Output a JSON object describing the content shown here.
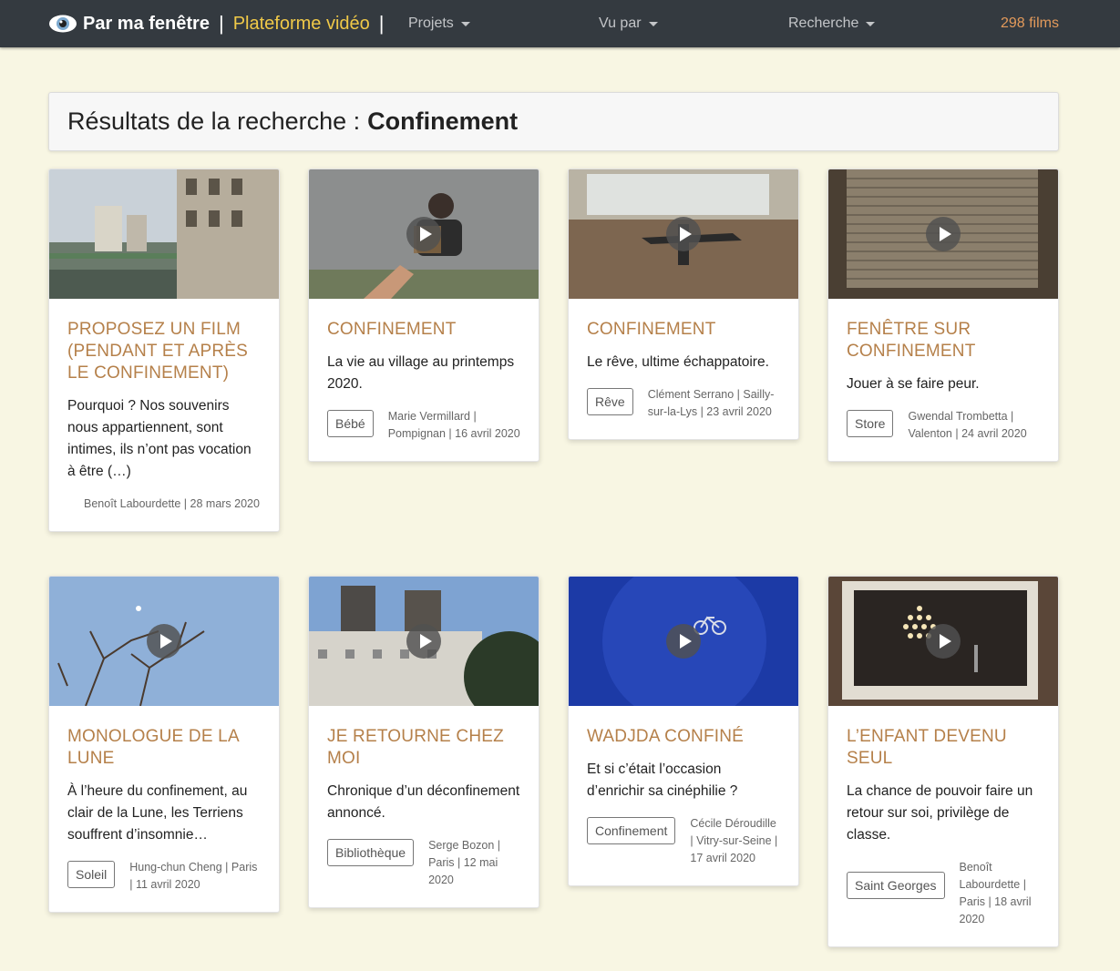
{
  "navbar": {
    "brand": "Par ma fenêtre",
    "separator": "|",
    "subtitle": "Plateforme vidéo",
    "menu": [
      {
        "label": "Projets"
      },
      {
        "label": "Vu par"
      },
      {
        "label": "Recherche"
      }
    ],
    "count": "298 films"
  },
  "search": {
    "prefix": "Résultats de la recherche :",
    "query": "Confinement"
  },
  "colors": {
    "navbar_bg": "#343a40",
    "brand_accent": "#f0c948",
    "count_accent": "#e39a5b",
    "title_accent": "#b5804a",
    "page_bg": "#f8f6e3"
  },
  "cards": [
    {
      "title": "Proposez un film (pendant et après le confinement)",
      "desc": "Pourquoi ? Nos souvenirs nous appartiennent, sont intimes, ils n’ont pas vocation à être (…)",
      "tag": "",
      "meta": "Benoît Labourdette | 28 mars 2020",
      "has_play": false,
      "thumb": "city-view"
    },
    {
      "title": "Confinement",
      "desc": "La vie au village au printemps 2020.",
      "tag": "Bébé",
      "meta": "Marie Vermillard | Pompignan | 16 avril 2020",
      "has_play": true,
      "thumb": "man-street"
    },
    {
      "title": "Confinement",
      "desc": "Le rêve, ultime échappatoire.",
      "tag": "Rêve",
      "meta": "Clément Serrano | Sailly-sur-la-Lys | 23 avril 2020",
      "has_play": true,
      "thumb": "toy-plane"
    },
    {
      "title": "Fenêtre sur confinement",
      "desc": "Jouer à se faire peur.",
      "tag": "Store",
      "meta": "Gwendal Trombetta | Valenton | 24 avril 2020",
      "has_play": true,
      "thumb": "shutter"
    },
    {
      "title": "Monologue de la Lune",
      "desc": "À l’heure du confinement, au clair de la Lune, les Terriens souffrent d’insomnie…",
      "tag": "Soleil",
      "meta": "Hung-chun Cheng | Paris | 11 avril 2020",
      "has_play": true,
      "thumb": "moon-sky"
    },
    {
      "title": "Je retourne chez moi",
      "desc": "Chronique d’un déconfinement annoncé.",
      "tag": "Bibliothèque",
      "meta": "Serge Bozon | Paris | 12 mai 2020",
      "has_play": true,
      "thumb": "towers"
    },
    {
      "title": "Wadjda confiné",
      "desc": "Et si c’était l’occasion d’enrichir sa cinéphilie ?",
      "tag": "Confinement",
      "meta": "Cécile Déroudille | Vitry-sur-Seine | 17 avril 2020",
      "has_play": true,
      "thumb": "blue-bike"
    },
    {
      "title": "L’enfant devenu seul",
      "desc": "La chance de pouvoir faire un retour sur soi, privilège de classe.",
      "tag": "Saint Georges",
      "meta": "Benoît Labourdette | Paris | 18 avril 2020",
      "has_play": true,
      "thumb": "dark-photo"
    }
  ]
}
